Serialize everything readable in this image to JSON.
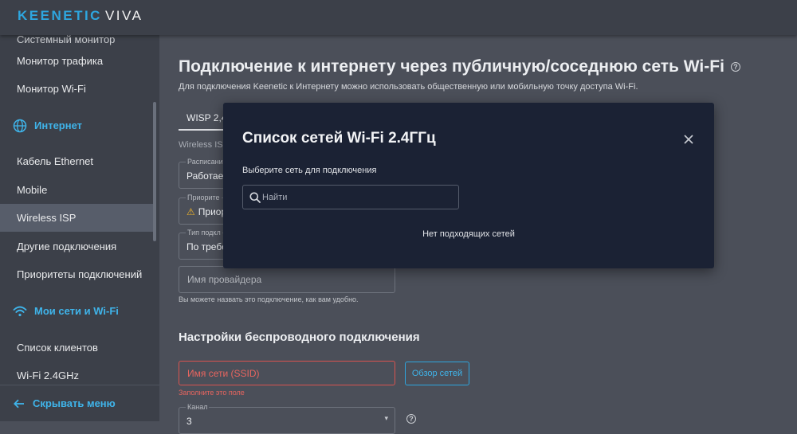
{
  "brand": {
    "name": "KEENETIC",
    "model": "VIVA"
  },
  "sidebar": {
    "items": [
      {
        "label": "Системный монитор"
      },
      {
        "label": "Монитор трафика"
      },
      {
        "label": "Монитор Wi-Fi"
      },
      {
        "label": "Интернет"
      },
      {
        "label": "Кабель Ethernet"
      },
      {
        "label": "Mobile"
      },
      {
        "label": "Wireless ISP"
      },
      {
        "label": "Другие подключения"
      },
      {
        "label": "Приоритеты подключений"
      },
      {
        "label": "Мои сети и Wi-Fi"
      },
      {
        "label": "Список клиентов"
      },
      {
        "label": "Wi-Fi 2.4GHz"
      }
    ],
    "footer_label": "Скрывать меню"
  },
  "page": {
    "title": "Подключение к интернету через публичную/соседнюю сеть Wi-Fi",
    "help": "?",
    "description": "Для подключения Keenetic к Интернету можно использовать общественную или мобильную точку доступа Wi-Fi.",
    "tab": "WISP 2,4",
    "wireless_frag": "Wireless IS",
    "schedule_label": "Расписани",
    "schedule_value": "Работает",
    "priority_label": "Приорите",
    "priority_value": "Приор",
    "type_label": "Тип подкл",
    "type_value": "По требо",
    "provider_placeholder": "Имя провайдера",
    "provider_hint": "Вы можете назвать это подключение, как вам удобно.",
    "wireless_section": "Настройки беспроводного подключения",
    "ssid_placeholder": "Имя сети (SSID)",
    "ssid_error": "Заполните это поле",
    "scan_button": "Обзор сетей",
    "channel_label": "Канал",
    "channel_value": "3"
  },
  "modal": {
    "title": "Список сетей Wi-Fi 2.4ГГц",
    "subtitle": "Выберите сеть для подключения",
    "search_placeholder": "Найти",
    "empty_text": "Нет подходящих сетей"
  },
  "colors": {
    "accent": "#2ea6df",
    "error": "#e8655f",
    "warning": "#f0b429",
    "modal_bg": "#1b2234",
    "page_bg": "#4b4f59"
  }
}
